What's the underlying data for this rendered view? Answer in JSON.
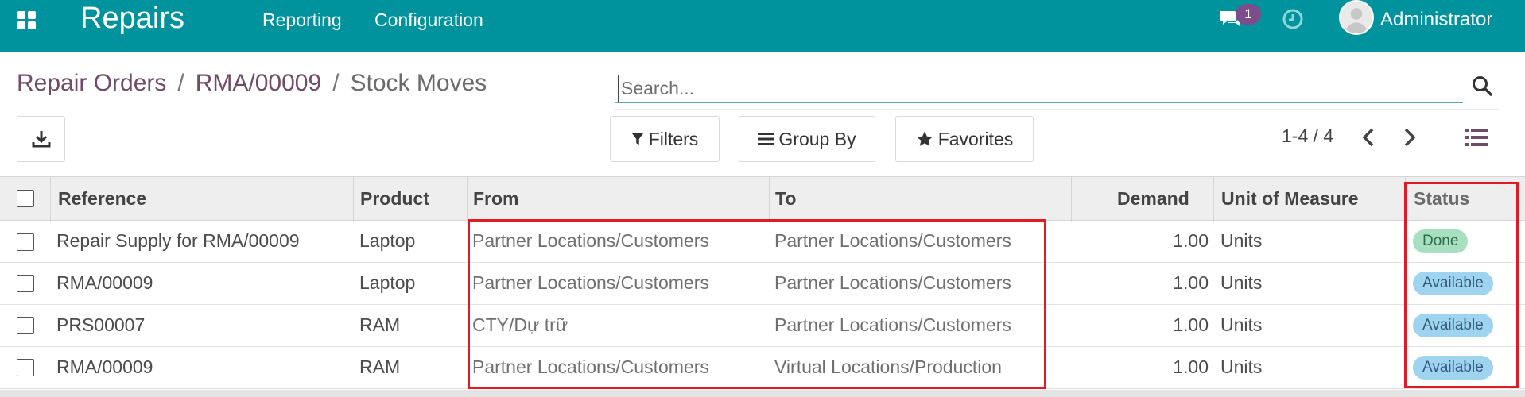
{
  "navbar": {
    "app_title": "Repairs",
    "menu": [
      "Reporting",
      "Configuration"
    ],
    "chat_badge": "1",
    "user_name": "Administrator",
    "icons": [
      "apps-grid-icon",
      "chat-icon",
      "clock-icon",
      "avatar"
    ]
  },
  "breadcrumb": {
    "items": [
      "Repair Orders",
      "RMA/00009"
    ],
    "current": "Stock Moves",
    "separator": "/"
  },
  "search": {
    "placeholder": "Search..."
  },
  "buttons": {
    "filters": "Filters",
    "group_by": "Group By",
    "favorites": "Favorites"
  },
  "pager": {
    "text": "1-4 / 4"
  },
  "table": {
    "columns": [
      "Reference",
      "Product",
      "From",
      "To",
      "Demand",
      "Unit of Measure",
      "Status"
    ],
    "rows": [
      [
        "Repair Supply for RMA/00009",
        "Laptop",
        "Partner Locations/Customers",
        "Partner Locations/Customers",
        "1.00",
        "Units",
        "Done"
      ],
      [
        "RMA/00009",
        "Laptop",
        "Partner Locations/Customers",
        "Partner Locations/Customers",
        "1.00",
        "Units",
        "Available"
      ],
      [
        "PRS00007",
        "RAM",
        "CTY/Dự trữ",
        "Partner Locations/Customers",
        "1.00",
        "Units",
        "Available"
      ],
      [
        "RMA/00009",
        "RAM",
        "Partner Locations/Customers",
        "Virtual Locations/Production",
        "1.00",
        "Units",
        "Available"
      ]
    ]
  },
  "colors": {
    "navbar": "#00939d",
    "breadcrumb_link": "#714b67",
    "badge_done": "#a8dfc1",
    "badge_available": "#9fd4f0",
    "highlight": "#e01b24"
  }
}
